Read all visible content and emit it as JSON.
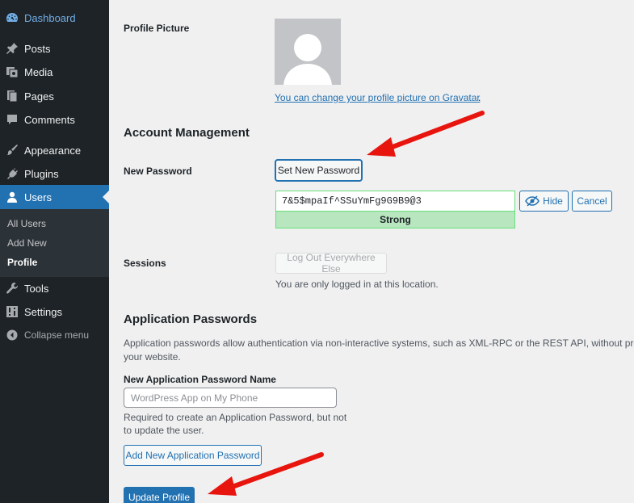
{
  "sidebar": {
    "items": [
      {
        "label": "Dashboard",
        "icon": "dashboard-icon"
      },
      {
        "label": "Posts",
        "icon": "pin-icon"
      },
      {
        "label": "Media",
        "icon": "media-icon"
      },
      {
        "label": "Pages",
        "icon": "pages-icon"
      },
      {
        "label": "Comments",
        "icon": "comment-icon"
      },
      {
        "label": "Appearance",
        "icon": "brush-icon"
      },
      {
        "label": "Plugins",
        "icon": "plugin-icon"
      },
      {
        "label": "Users",
        "icon": "users-icon"
      },
      {
        "label": "Tools",
        "icon": "wrench-icon"
      },
      {
        "label": "Settings",
        "icon": "settings-icon"
      },
      {
        "label": "Collapse menu",
        "icon": "collapse-icon"
      }
    ],
    "submenu": [
      "All Users",
      "Add New",
      "Profile"
    ]
  },
  "profile_picture": {
    "label": "Profile Picture",
    "gravatar_link": "You can change your profile picture on Gravatar",
    "gravatar_suffix": "."
  },
  "account": {
    "heading": "Account Management",
    "new_password_label": "New Password",
    "set_password_button": "Set New Password",
    "password_value": "7&5$mpaIf^SSuYmFg9G9B9@3",
    "hide_button": "Hide",
    "cancel_button": "Cancel",
    "strength": "Strong",
    "sessions_label": "Sessions",
    "logout_button": "Log Out Everywhere Else",
    "sessions_note": "You are only logged in at this location."
  },
  "app_passwords": {
    "heading": "Application Passwords",
    "description_line1": "Application passwords allow authentication via non-interactive systems, such as XML-RPC or the REST API, without providing your",
    "description_line2": "your website.",
    "name_label": "New Application Password Name",
    "name_placeholder": "WordPress App on My Phone",
    "help_line1": "Required to create an Application Password, but not",
    "help_line2": "to update the user.",
    "add_button": "Add New Application Password"
  },
  "update_button": "Update Profile",
  "colors": {
    "sidebar_bg": "#1d2327",
    "accent": "#2271b1",
    "strong_bg": "#b8e6bf",
    "arrow": "#e8150e"
  }
}
